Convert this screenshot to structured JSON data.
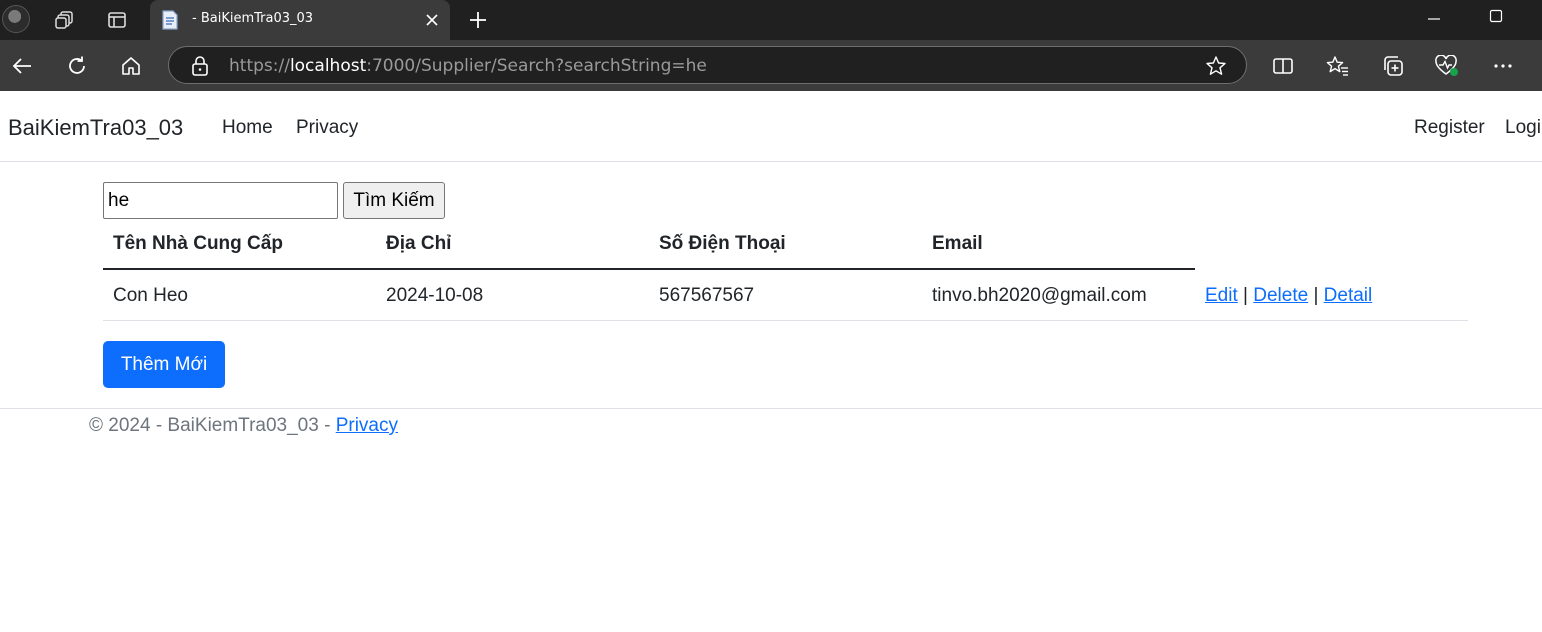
{
  "browser": {
    "tab_title": "- BaiKiemTra03_03",
    "url": {
      "scheme": "https://",
      "host": "localhost",
      "rest": ":7000/Supplier/Search?searchString=he"
    },
    "icons": [
      "profile-avatar",
      "workspaces-icon",
      "tab-actions-icon",
      "page-favicon",
      "close-icon",
      "plus-icon",
      "back-arrow-icon",
      "refresh-icon",
      "home-icon",
      "lock-icon",
      "star-icon",
      "split-screen-icon",
      "favorites-icon",
      "collections-icon",
      "browser-essentials-icon",
      "more-icon",
      "minimize-icon",
      "maximize-icon"
    ]
  },
  "navbar": {
    "brand": "BaiKiemTra03_03",
    "links": [
      "Home",
      "Privacy"
    ],
    "right_links": [
      "Register",
      "Logi"
    ]
  },
  "search": {
    "value": "he",
    "button_label": "Tìm Kiếm"
  },
  "table": {
    "headers": [
      "Tên Nhà Cung Cấp",
      "Địa Chỉ",
      "Số Điện Thoại",
      "Email"
    ],
    "rows": [
      {
        "cells": [
          "Con Heo",
          "2024-10-08",
          "567567567",
          "tinvo.bh2020@gmail.com"
        ],
        "actions": [
          "Edit",
          "Delete",
          "Detail"
        ],
        "separator": "|"
      }
    ]
  },
  "add_button": "Thêm Mới",
  "footer": {
    "text": "© 2024 - BaiKiemTra03_03 - ",
    "link": "Privacy"
  },
  "colors": {
    "primary": "#0d6efd",
    "chrome_dark": "#202020",
    "chrome_toolbar": "#3b3b3b",
    "text": "#212529",
    "muted": "#6c757d"
  }
}
